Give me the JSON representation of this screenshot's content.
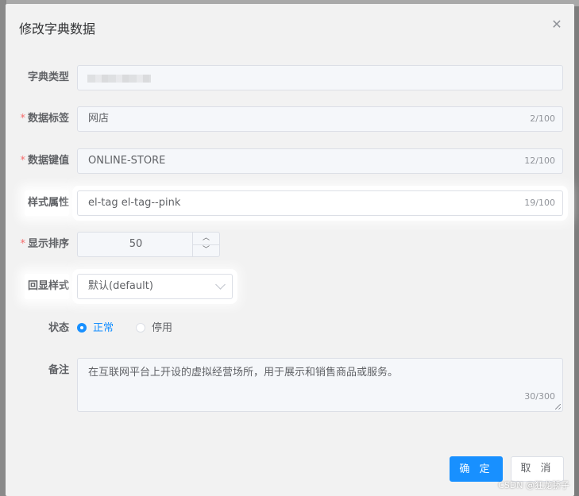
{
  "dialog": {
    "title": "修改字典数据",
    "close_icon": "close-icon"
  },
  "form": {
    "dict_type": {
      "label": "字典类型",
      "value": ""
    },
    "data_label": {
      "label": "数据标签",
      "required_mark": "*",
      "value": "网店",
      "count": "2/100"
    },
    "data_value": {
      "label": "数据键值",
      "required_mark": "*",
      "value": "ONLINE-STORE",
      "count": "12/100"
    },
    "css_class": {
      "label": "样式属性",
      "value": "el-tag el-tag--pink",
      "count": "19/100"
    },
    "sort": {
      "label": "显示排序",
      "required_mark": "*",
      "value": "50",
      "up_icon": "chevron-up-icon",
      "down_icon": "chevron-down-icon"
    },
    "list_class": {
      "label": "回显样式",
      "value": "默认(default)",
      "icon": "chevron-down-icon"
    },
    "status": {
      "label": "状态",
      "options": [
        {
          "label": "正常",
          "checked": true
        },
        {
          "label": "停用",
          "checked": false
        }
      ]
    },
    "remark": {
      "label": "备注",
      "value": "在互联网平台上开设的虚拟经营场所，用于展示和销售商品或服务。",
      "count": "30/300"
    }
  },
  "footer": {
    "confirm_label": "确 定",
    "cancel_label": "取 消"
  },
  "watermark": "CSDN @狂龙骄子",
  "colors": {
    "primary": "#1890ff",
    "required": "#f56c6c",
    "dialog_bg": "#f2f2f2"
  }
}
